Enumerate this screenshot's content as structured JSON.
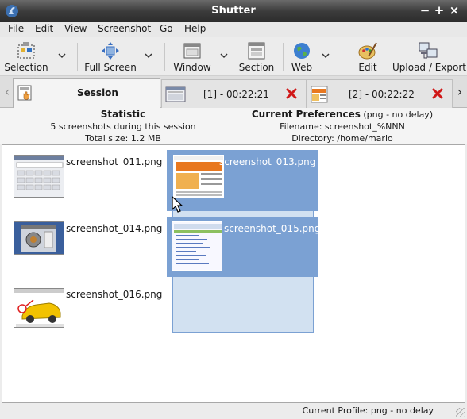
{
  "window": {
    "title": "Shutter"
  },
  "menu": [
    "File",
    "Edit",
    "View",
    "Screenshot",
    "Go",
    "Help"
  ],
  "toolbar": {
    "selection": "Selection",
    "full_screen": "Full Screen",
    "window": "Window",
    "section": "Section",
    "web": "Web",
    "edit": "Edit",
    "upload_export": "Upload / Export"
  },
  "tabs": [
    {
      "label": "Session"
    },
    {
      "label": "[1] - 00:22:21"
    },
    {
      "label": "[2] - 00:22:22"
    }
  ],
  "statistic": {
    "heading": "Statistic",
    "count": "5 screenshots during this session",
    "total": "Total size: 1.2 MB"
  },
  "preferences": {
    "heading": "Current Preferences",
    "heading_suffix": " (png - no delay)",
    "filename": "Filename: screenshot_%NNN",
    "directory": "Directory: /home/mario"
  },
  "screenshots": [
    {
      "name": "screenshot_011.png",
      "selected": false
    },
    {
      "name": "screenshot_013.png",
      "selected": true
    },
    {
      "name": "screenshot_014.png",
      "selected": false
    },
    {
      "name": "screenshot_015.png",
      "selected": true
    },
    {
      "name": "screenshot_016.png",
      "selected": false
    }
  ],
  "status": {
    "profile": "Current Profile: png - no delay"
  }
}
